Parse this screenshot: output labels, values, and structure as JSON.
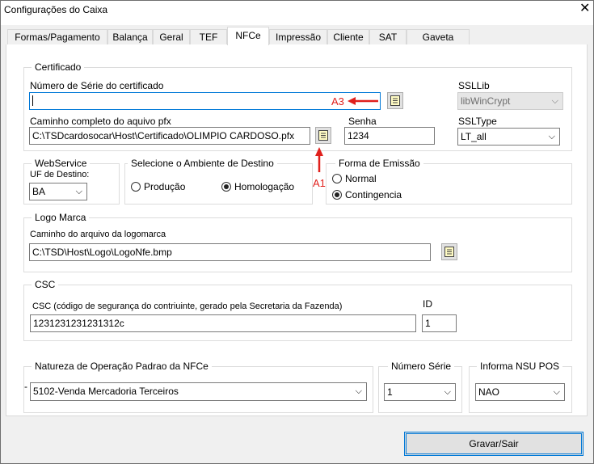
{
  "window": {
    "title": "Configurações do Caixa",
    "close_icon": "close-icon"
  },
  "tabs": [
    {
      "label": "Formas/Pagamento",
      "active": false
    },
    {
      "label": "Balança",
      "active": false
    },
    {
      "label": "Geral",
      "active": false
    },
    {
      "label": "TEF",
      "active": false
    },
    {
      "label": "NFCe",
      "active": true
    },
    {
      "label": "Impressão",
      "active": false
    },
    {
      "label": "Cliente",
      "active": false
    },
    {
      "label": "SAT",
      "active": false
    },
    {
      "label": "Gaveta",
      "active": false
    }
  ],
  "certificado": {
    "legend": "Certificado",
    "serial_label": "Número de Série do certificado",
    "serial_value": "",
    "path_label": "Caminho completo do aquivo pfx",
    "path_value": "C:\\TSDcardosocar\\Host\\Certificado\\OLIMPIO CARDOSO.pfx",
    "senha_label": "Senha",
    "senha_value": "1234",
    "ssllib_label": "SSLLib",
    "ssllib_value": "libWinCrypt",
    "ssltype_label": "SSLType",
    "ssltype_value": "LT_all"
  },
  "annotations": {
    "a3": "A3",
    "a1": "A1",
    "color": "#e0201c"
  },
  "webservice": {
    "legend": "WebService",
    "uf_label": "UF de Destino:",
    "uf_value": "BA"
  },
  "ambiente": {
    "legend": "Selecione o Ambiente de Destino",
    "options": [
      {
        "label": "Produção",
        "selected": false
      },
      {
        "label": "Homologação",
        "selected": true
      }
    ]
  },
  "emissao": {
    "legend": "Forma de Emissão",
    "options": [
      {
        "label": "Normal",
        "selected": false
      },
      {
        "label": "Contingencia",
        "selected": true
      }
    ]
  },
  "logo": {
    "legend": "Logo Marca",
    "path_label": "Caminho do arquivo da logomarca",
    "path_value": "C:\\TSD\\Host\\Logo\\LogoNfe.bmp"
  },
  "csc": {
    "legend": "CSC",
    "csc_label": "CSC (código de segurança do contriuinte, gerado pela Secretaria da Fazenda)",
    "csc_value": "1231231231231312c",
    "id_label": "ID",
    "id_value": "1"
  },
  "natureza": {
    "legend": "Natureza de Operação Padrao  da NFCe",
    "dash": "-",
    "value": "5102-Venda Mercadoria Terceiros"
  },
  "numero_serie": {
    "legend": "Número Série",
    "value": "1"
  },
  "nsu_pos": {
    "legend": "Informa NSU  POS",
    "value": "NAO"
  },
  "footer": {
    "save_label": "Gravar/Sair"
  },
  "colors": {
    "accent": "#0078d7",
    "panel_bg": "#ffffff",
    "window_bg": "#f0f0f0"
  }
}
